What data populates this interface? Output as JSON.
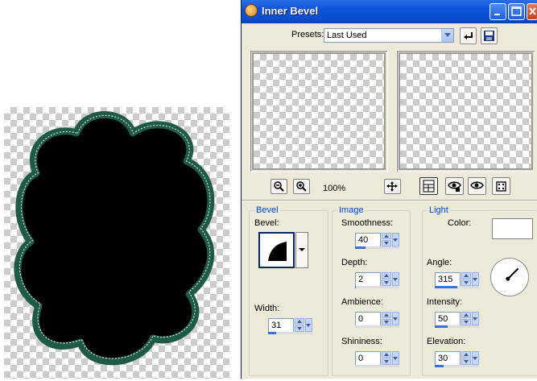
{
  "window": {
    "title": "Inner Bevel"
  },
  "presets": {
    "label": "Presets:",
    "value": "Last Used"
  },
  "zoom": {
    "value": "100%"
  },
  "bevel_group": {
    "legend": "Bevel",
    "bevel_label": "Bevel:",
    "width_label": "Width:",
    "width_value": "31",
    "width_fraction": 0.31
  },
  "image_group": {
    "legend": "Image",
    "smoothness_label": "Smoothness:",
    "smoothness_value": "40",
    "smoothness_fraction": 0.4,
    "depth_label": "Depth:",
    "depth_value": "2",
    "depth_fraction": 0.03,
    "ambience_label": "Ambience:",
    "ambience_value": "0",
    "ambience_fraction": 0.0,
    "shininess_label": "Shininess:",
    "shininess_value": "0",
    "shininess_fraction": 0.0
  },
  "light_group": {
    "legend": "Light",
    "color_label": "Color:",
    "color_value": "#ffffff",
    "angle_label": "Angle:",
    "angle_value": "315",
    "angle_fraction": 0.875,
    "intensity_label": "Intensity:",
    "intensity_value": "50",
    "intensity_fraction": 0.5,
    "elevation_label": "Elevation:",
    "elevation_value": "30",
    "elevation_fraction": 0.33
  },
  "icons": {
    "title": "app-icon",
    "minimize": "minimize-icon",
    "maximize": "maximize-icon",
    "close": "close-icon",
    "reset": "reset-icon",
    "save_preset": "save-icon",
    "zoom_out": "zoom-out-icon",
    "zoom_in": "zoom-in-icon",
    "pan": "pan-icon",
    "preview_toggle": "preview-toggle-icon",
    "proof": "proof-icon",
    "auto_proof": "auto-proof-icon",
    "randomize": "randomize-icon"
  },
  "colors": {
    "titlebar": "#0c52d6",
    "dialog_bg": "#ece9d8",
    "legend": "#0046d5",
    "shape_fill": "#000000",
    "shape_border": "#1e5a45"
  }
}
